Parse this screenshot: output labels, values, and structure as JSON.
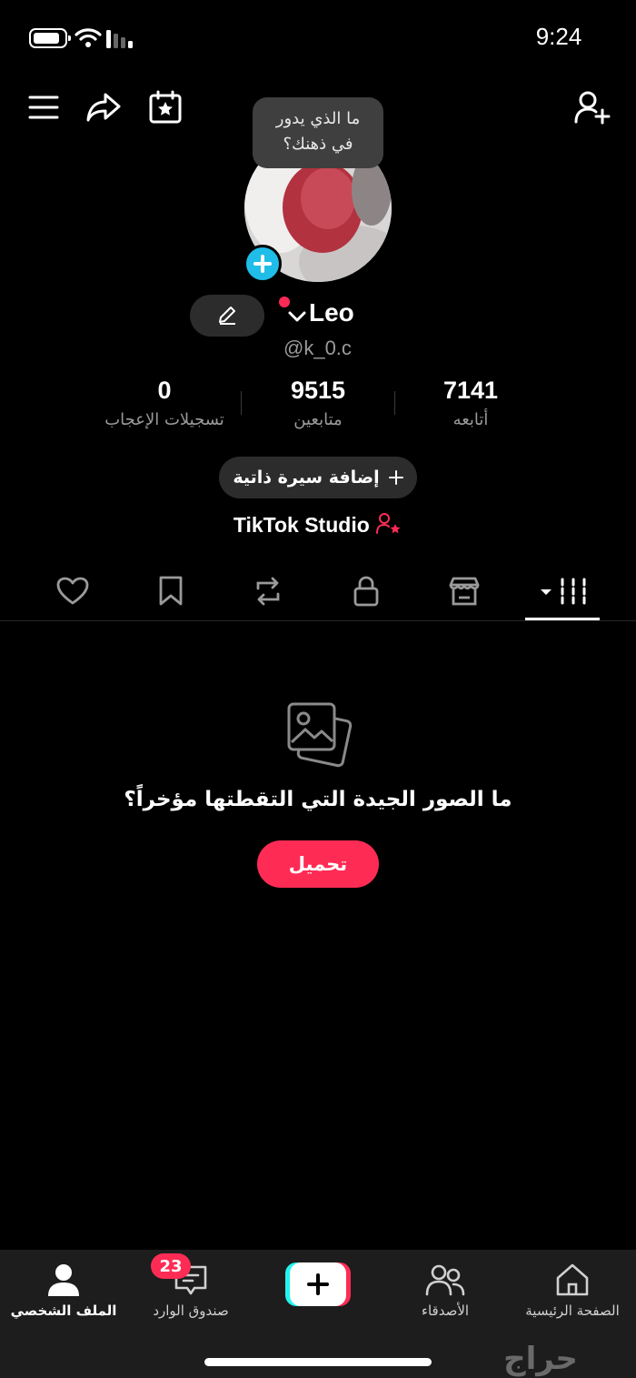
{
  "status_bar": {
    "time": "9:24"
  },
  "profile": {
    "note_line1": "ما الذي يدور",
    "note_line2": "في ذهنك؟",
    "name": "Leo",
    "handle": "@k_0.c"
  },
  "stats": [
    {
      "value": "7141",
      "label": "أتابعه"
    },
    {
      "value": "9515",
      "label": "متابعين"
    },
    {
      "value": "0",
      "label": "تسجيلات الإعجاب"
    }
  ],
  "bio_button": {
    "label": "إضافة سيرة ذاتية",
    "icon": "plus-icon"
  },
  "studio_link": {
    "label": "TikTok Studio",
    "icon": "person-star-icon"
  },
  "tabs": [
    "videos-grid-icon",
    "shop-icon",
    "lock-icon",
    "repost-icon",
    "bookmark-icon",
    "heart-icon"
  ],
  "empty_state": {
    "title": "ما الصور الجيدة التي التقطتها مؤخراً؟",
    "button": "تحميل"
  },
  "bottom_nav": {
    "home": "الصفحة الرئيسية",
    "friends": "الأصدقاء",
    "inbox": "صندوق الوارد",
    "inbox_badge": "23",
    "profile": "الملف الشخصي"
  },
  "watermark": "حراج",
  "colors": {
    "accent": "#fe2c55",
    "badge_blue": "#20bde8",
    "background": "#000000"
  }
}
